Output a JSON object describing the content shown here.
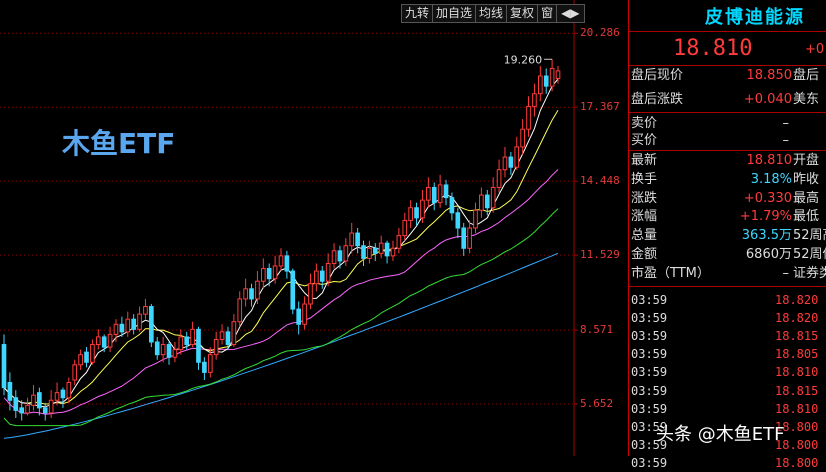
{
  "toolbar": {
    "items": [
      "九转",
      "加自选",
      "均线",
      "复权",
      "窗",
      "◀▶"
    ]
  },
  "watermark_left": "木鱼ETF",
  "watermark_bottom": "头条 @木鱼ETF",
  "quote": {
    "name": "皮博迪能源",
    "price": "18.810",
    "change_prefix": "+0",
    "after_hours_price_label": "盘后现价",
    "after_hours_price": "18.850",
    "after_hours_price_extra": "盘后",
    "after_hours_change_label": "盘后涨跌",
    "after_hours_change": "+0.040",
    "after_hours_change_extra": "美东",
    "ask_label": "卖价",
    "ask_value": "–",
    "bid_label": "买价",
    "bid_value": "–",
    "stats": [
      {
        "label": "最新",
        "value": "18.810",
        "extra": "开盘",
        "color": "red"
      },
      {
        "label": "换手",
        "value": "3.18%",
        "extra": "昨收",
        "color": "cyan"
      },
      {
        "label": "涨跌",
        "value": "+0.330",
        "extra": "最高",
        "color": "red"
      },
      {
        "label": "涨幅",
        "value": "+1.79%",
        "extra": "最低",
        "color": "red"
      },
      {
        "label": "总量",
        "value": "363.5万",
        "extra": "52周高",
        "color": "cyan"
      },
      {
        "label": "金额",
        "value": "6860万",
        "extra": "52周低",
        "color": "gray"
      },
      {
        "label": "市盈（TTM）",
        "value": "–",
        "extra": "证券类",
        "color": "gray"
      }
    ],
    "ticks": [
      {
        "time": "03:59",
        "price": "18.820"
      },
      {
        "time": "03:59",
        "price": "18.820"
      },
      {
        "time": "03:59",
        "price": "18.815"
      },
      {
        "time": "03:59",
        "price": "18.805"
      },
      {
        "time": "03:59",
        "price": "18.810"
      },
      {
        "time": "03:59",
        "price": "18.815"
      },
      {
        "time": "03:59",
        "price": "18.810"
      },
      {
        "time": "03:59",
        "price": "18.800"
      },
      {
        "time": "03:59",
        "price": "18.800"
      },
      {
        "time": "03:59",
        "price": "18.800"
      }
    ]
  },
  "chart_data": {
    "type": "candlestick",
    "y_ticks": [
      "20.286",
      "17.367",
      "14.448",
      "11.529",
      "8.571",
      "5.652"
    ],
    "ylim": [
      3.6,
      21.6
    ],
    "grid": true,
    "annotation": {
      "text": "19.260",
      "value": 19.26,
      "index": 93
    },
    "colors": {
      "up": "#ff3b3b",
      "down": "#3fd7ff",
      "ma5": "#ffffff",
      "ma10": "#ffff55",
      "ma20": "#ff66ff",
      "ma30": "#33dd33",
      "ma60": "#33aaff"
    },
    "candles": [
      [
        8.0,
        6.3,
        8.4,
        6.0
      ],
      [
        6.5,
        5.8,
        6.9,
        5.4
      ],
      [
        5.9,
        5.4,
        6.2,
        5.1
      ],
      [
        5.5,
        5.3,
        5.8,
        5.0
      ],
      [
        5.3,
        5.6,
        5.9,
        5.2
      ],
      [
        5.6,
        6.0,
        6.4,
        5.4
      ],
      [
        6.1,
        5.5,
        6.3,
        5.2
      ],
      [
        5.5,
        5.3,
        5.7,
        5.0
      ],
      [
        5.3,
        5.8,
        6.2,
        5.1
      ],
      [
        5.8,
        6.1,
        6.5,
        5.6
      ],
      [
        6.2,
        5.9,
        6.3,
        5.5
      ],
      [
        5.9,
        6.5,
        6.7,
        5.7
      ],
      [
        6.6,
        7.2,
        7.4,
        6.4
      ],
      [
        7.2,
        7.6,
        7.8,
        7.0
      ],
      [
        7.7,
        7.3,
        7.9,
        7.1
      ],
      [
        7.3,
        8.0,
        8.2,
        7.2
      ],
      [
        8.0,
        8.3,
        8.6,
        7.8
      ],
      [
        8.3,
        7.9,
        8.4,
        7.7
      ],
      [
        7.9,
        8.4,
        8.7,
        7.7
      ],
      [
        8.4,
        8.8,
        9.0,
        8.1
      ],
      [
        8.8,
        8.5,
        9.1,
        8.3
      ],
      [
        8.5,
        9.0,
        9.3,
        8.3
      ],
      [
        9.0,
        8.6,
        9.2,
        8.4
      ],
      [
        8.6,
        9.2,
        9.5,
        8.5
      ],
      [
        9.2,
        9.5,
        9.8,
        9.0
      ],
      [
        9.5,
        8.1,
        9.6,
        7.9
      ],
      [
        8.1,
        7.6,
        8.3,
        7.4
      ],
      [
        7.6,
        8.0,
        8.3,
        7.3
      ],
      [
        8.0,
        7.5,
        8.1,
        7.2
      ],
      [
        7.5,
        7.8,
        8.1,
        7.3
      ],
      [
        7.8,
        8.3,
        8.6,
        7.6
      ],
      [
        8.3,
        8.0,
        8.5,
        7.8
      ],
      [
        8.0,
        8.6,
        8.9,
        7.9
      ],
      [
        8.6,
        7.3,
        8.7,
        7.0
      ],
      [
        7.3,
        6.9,
        7.5,
        6.6
      ],
      [
        6.9,
        7.6,
        7.9,
        6.7
      ],
      [
        7.6,
        8.2,
        8.5,
        7.4
      ],
      [
        8.2,
        8.5,
        8.8,
        8.0
      ],
      [
        8.5,
        8.0,
        8.7,
        7.8
      ],
      [
        8.0,
        8.9,
        9.2,
        7.9
      ],
      [
        8.9,
        9.8,
        10.1,
        8.7
      ],
      [
        9.8,
        10.2,
        10.6,
        9.5
      ],
      [
        10.2,
        9.8,
        10.4,
        9.5
      ],
      [
        9.8,
        10.5,
        10.9,
        9.6
      ],
      [
        10.5,
        11.0,
        11.4,
        10.2
      ],
      [
        11.0,
        10.6,
        11.2,
        10.3
      ],
      [
        10.6,
        11.1,
        11.5,
        10.4
      ],
      [
        11.1,
        11.5,
        11.8,
        10.9
      ],
      [
        11.5,
        10.9,
        11.7,
        10.6
      ],
      [
        10.9,
        9.4,
        11.0,
        9.2
      ],
      [
        9.4,
        8.8,
        9.7,
        8.4
      ],
      [
        8.8,
        9.6,
        9.9,
        8.6
      ],
      [
        9.6,
        10.4,
        10.8,
        9.4
      ],
      [
        10.4,
        10.9,
        11.2,
        10.1
      ],
      [
        10.9,
        10.5,
        11.1,
        10.2
      ],
      [
        10.5,
        11.2,
        11.6,
        10.3
      ],
      [
        11.2,
        11.7,
        12.0,
        11.0
      ],
      [
        11.7,
        11.3,
        11.9,
        11.0
      ],
      [
        11.3,
        11.9,
        12.2,
        11.1
      ],
      [
        11.9,
        12.4,
        12.8,
        11.6
      ],
      [
        12.4,
        11.9,
        12.6,
        11.6
      ],
      [
        11.9,
        11.4,
        12.1,
        11.1
      ],
      [
        11.4,
        11.8,
        12.1,
        11.2
      ],
      [
        11.8,
        11.6,
        12.0,
        11.3
      ],
      [
        11.6,
        12.0,
        12.3,
        11.4
      ],
      [
        12.0,
        11.5,
        12.1,
        11.2
      ],
      [
        11.5,
        11.8,
        12.1,
        11.3
      ],
      [
        11.8,
        12.3,
        12.6,
        11.6
      ],
      [
        12.3,
        12.9,
        13.2,
        12.1
      ],
      [
        12.9,
        13.4,
        13.7,
        12.6
      ],
      [
        13.4,
        13.0,
        13.6,
        12.7
      ],
      [
        13.0,
        13.7,
        14.1,
        12.8
      ],
      [
        13.7,
        14.2,
        14.6,
        13.4
      ],
      [
        14.2,
        13.6,
        14.4,
        13.3
      ],
      [
        13.6,
        14.3,
        14.7,
        13.4
      ],
      [
        14.3,
        13.8,
        14.5,
        13.5
      ],
      [
        13.8,
        13.2,
        14.0,
        12.9
      ],
      [
        13.2,
        12.6,
        13.4,
        12.2
      ],
      [
        12.6,
        11.8,
        12.8,
        11.5
      ],
      [
        11.8,
        12.6,
        12.9,
        11.6
      ],
      [
        12.6,
        13.3,
        13.6,
        12.4
      ],
      [
        13.3,
        13.9,
        14.2,
        13.0
      ],
      [
        13.9,
        13.4,
        14.1,
        13.1
      ],
      [
        13.4,
        14.2,
        14.6,
        13.2
      ],
      [
        14.2,
        14.9,
        15.3,
        14.0
      ],
      [
        14.9,
        15.4,
        15.8,
        14.6
      ],
      [
        15.4,
        15.0,
        15.6,
        14.7
      ],
      [
        15.0,
        15.8,
        16.2,
        14.9
      ],
      [
        15.8,
        16.5,
        16.9,
        15.5
      ],
      [
        16.5,
        17.4,
        17.8,
        16.2
      ],
      [
        17.4,
        17.9,
        18.3,
        17.0
      ],
      [
        17.9,
        18.6,
        19.0,
        17.6
      ],
      [
        18.6,
        18.2,
        18.9,
        17.9
      ],
      [
        18.2,
        18.9,
        19.26,
        18.0
      ],
      [
        18.5,
        18.8,
        19.0,
        18.3
      ]
    ]
  }
}
